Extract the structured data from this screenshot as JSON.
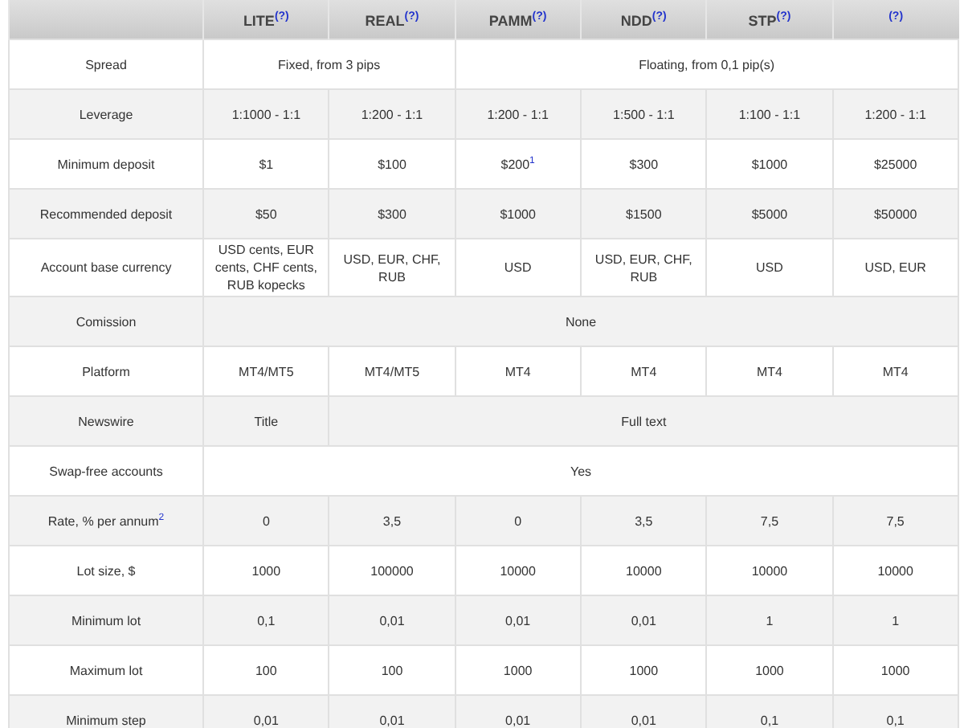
{
  "columns": [
    {
      "label": "LITE",
      "note": "(?)"
    },
    {
      "label": "REAL",
      "note": "(?)"
    },
    {
      "label": "PAMM",
      "note": "(?)"
    },
    {
      "label": "NDD",
      "note": "(?)"
    },
    {
      "label": "STP",
      "note": "(?)"
    },
    {
      "note": "(?)"
    }
  ],
  "rows": [
    {
      "label": "Spread",
      "cells": [
        {
          "text": "Fixed, from 3 pips"
        },
        {
          "joined": true
        },
        {
          "text": "Floating, from 0,1 pip(s)"
        },
        {
          "joined": true
        },
        {
          "joined": true
        },
        {
          "joined": true
        }
      ]
    },
    {
      "label": "Leverage",
      "cells": [
        {
          "text": "1:1000 - 1:1"
        },
        {
          "text": "1:200 - 1:1"
        },
        {
          "text": "1:200 - 1:1"
        },
        {
          "text": "1:500 - 1:1"
        },
        {
          "text": "1:100 - 1:1"
        },
        {
          "text": "1:200 - 1:1"
        }
      ]
    },
    {
      "label": "Minimum deposit",
      "cells": [
        {
          "text": "$1"
        },
        {
          "text": "$100"
        },
        {
          "text": "$200$^{1}$"
        },
        {
          "text": "$300"
        },
        {
          "text": "$1000"
        },
        {
          "text": "$25000"
        }
      ]
    },
    {
      "label": "Recommended deposit",
      "cells": [
        {
          "text": "$50"
        },
        {
          "text": "$300"
        },
        {
          "text": "$1000"
        },
        {
          "text": "$1500"
        },
        {
          "text": "$5000"
        },
        {
          "text": "$50000"
        }
      ]
    },
    {
      "label": "Account base currency",
      "cells": [
        {
          "text": "USD cents, EUR cents, CHF cents, RUB kopecks"
        },
        {
          "text": "USD, EUR, CHF, RUB"
        },
        {
          "text": "USD"
        },
        {
          "text": "USD, EUR, CHF, RUB"
        },
        {
          "text": "USD"
        },
        {
          "text": "USD, EUR"
        }
      ]
    },
    {
      "label": "Comission",
      "cells": [
        {
          "text": "None"
        },
        {
          "joined": true
        },
        {
          "joined": true
        },
        {
          "joined": true
        },
        {
          "joined": true
        },
        {
          "joined": true
        }
      ]
    },
    {
      "label": "Platform",
      "cells": [
        {
          "text": "MT4/MT5"
        },
        {
          "text": "MT4/MT5"
        },
        {
          "text": "MT4"
        },
        {
          "text": "MT4"
        },
        {
          "text": "MT4"
        },
        {
          "text": "MT4"
        }
      ]
    },
    {
      "label": "Newswire",
      "cells": [
        {
          "text": "Title"
        },
        {
          "text": "Full text"
        },
        {
          "joined": true
        },
        {
          "joined": true
        },
        {
          "joined": true
        },
        {
          "joined": true
        }
      ]
    },
    {
      "label": "Swap-free accounts",
      "cells": [
        {
          "text": "Yes"
        },
        {
          "joined": true
        },
        {
          "joined": true
        },
        {
          "joined": true
        },
        {
          "joined": true
        },
        {
          "joined": true
        }
      ]
    },
    {
      "label": "Rate, % per annum$^{2}$",
      "cells": [
        {
          "text": "0"
        },
        {
          "text": "3,5"
        },
        {
          "text": "0"
        },
        {
          "text": "3,5"
        },
        {
          "text": "7,5"
        },
        {
          "text": "7,5"
        }
      ]
    },
    {
      "label": "Lot size, $",
      "cells": [
        {
          "text": "1000"
        },
        {
          "text": "100000"
        },
        {
          "text": "10000"
        },
        {
          "text": "10000"
        },
        {
          "text": "10000"
        },
        {
          "text": "10000"
        }
      ]
    },
    {
      "label": "Minimum lot",
      "cells": [
        {
          "text": "0,1"
        },
        {
          "text": "0,01"
        },
        {
          "text": "0,01"
        },
        {
          "text": "0,01"
        },
        {
          "text": "1"
        },
        {
          "text": "1"
        }
      ]
    },
    {
      "label": "Maximum lot",
      "cells": [
        {
          "text": "100"
        },
        {
          "text": "100"
        },
        {
          "text": "1000"
        },
        {
          "text": "1000"
        },
        {
          "text": "1000"
        },
        {
          "text": "1000"
        }
      ]
    },
    {
      "label": "Minimum step",
      "cells": [
        {
          "text": "0,01"
        },
        {
          "text": "0,01"
        },
        {
          "text": "0,01"
        },
        {
          "text": "0,01"
        },
        {
          "text": "0,1"
        },
        {
          "text": "0,1"
        }
      ]
    }
  ]
}
